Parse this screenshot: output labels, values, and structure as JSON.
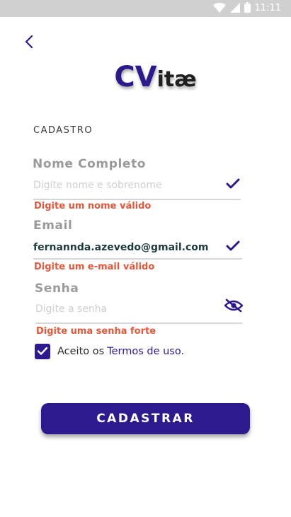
{
  "status_bar": {
    "time": "11:11",
    "icons": [
      "wifi-icon",
      "signal-icon",
      "battery-icon"
    ]
  },
  "header": {
    "back_icon": "chevron-left-icon",
    "logo_cv": "CV",
    "logo_itae": "itæ"
  },
  "form": {
    "section_title": "CADASTRO",
    "fields": [
      {
        "label": "Nome Completo",
        "value": "",
        "placeholder": "Digite nome e sobrenome",
        "error": "Digite um nome válido",
        "trailing_icon": "check-icon"
      },
      {
        "label": "Email",
        "value": "fernannda.azevedo@gmail.com",
        "placeholder": "",
        "error": "Digite um e-mail válido",
        "trailing_icon": "check-icon"
      },
      {
        "label": "Senha",
        "value": "",
        "placeholder": "Digite a senha",
        "error": "Digite uma senha forte",
        "trailing_icon": "eye-off-icon"
      }
    ],
    "terms": {
      "checked": true,
      "text": "Aceito os",
      "link": "Termos de uso."
    },
    "submit_label": "CADASTRAR"
  },
  "colors": {
    "primary": "#2d1a8e",
    "error": "#e4573a",
    "label_gray": "#9a9a9a",
    "status_bar": "#d0d0d0"
  }
}
